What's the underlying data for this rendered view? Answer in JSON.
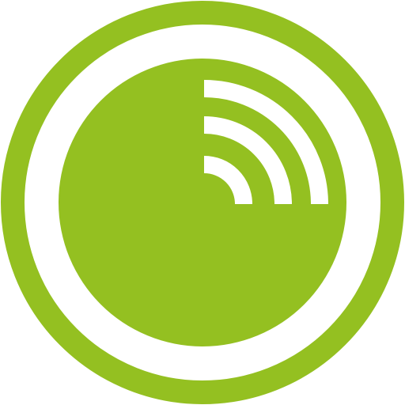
{
  "icon": {
    "name": "wireless-signal-disc-icon",
    "colors": {
      "brand": "#94c021",
      "background": "#ffffff"
    }
  }
}
